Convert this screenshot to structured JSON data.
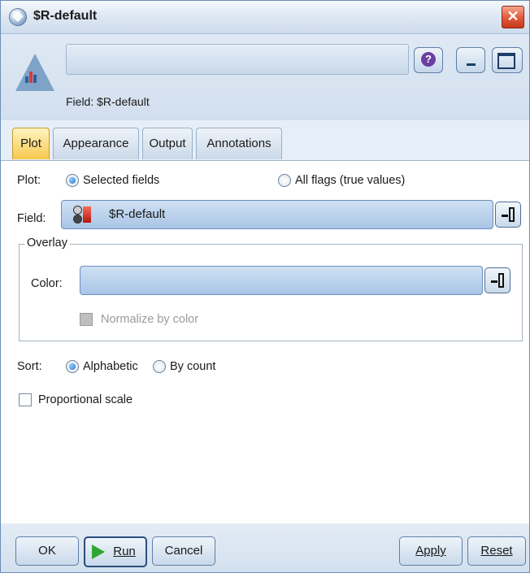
{
  "window": {
    "title": "$R-default",
    "close_glyph": "✕"
  },
  "header": {
    "name_value": "",
    "field_caption": "Field: $R-default",
    "help_glyph": "?",
    "icons": [
      "distribution-node-icon",
      "help-icon",
      "minimize-icon",
      "maximize-icon"
    ]
  },
  "tabs": [
    {
      "label": "Plot",
      "active": true
    },
    {
      "label": "Appearance",
      "active": false
    },
    {
      "label": "Output",
      "active": false
    },
    {
      "label": "Annotations",
      "active": false
    }
  ],
  "plot": {
    "plot_label": "Plot:",
    "selected_fields_label": "Selected fields",
    "all_flags_label": "All flags (true values)",
    "selected_option": "Selected fields",
    "field_label": "Field:",
    "field_value": "$R-default",
    "overlay_legend": "Overlay",
    "color_label": "Color:",
    "color_value": "",
    "normalize_label": "Normalize by color",
    "normalize_checked": false,
    "sort_label": "Sort:",
    "sort_alphabetic_label": "Alphabetic",
    "sort_count_label": "By count",
    "sort_selected": "Alphabetic",
    "proportional_label": "Proportional scale",
    "proportional_checked": false
  },
  "buttons": {
    "ok": "OK",
    "run": "Run",
    "cancel": "Cancel",
    "apply": "Apply",
    "reset": "Reset"
  },
  "colors": {
    "accent": "#f6c94d",
    "combo_fill": "#b9d1ec",
    "title_bar": "#dbe6f2"
  }
}
